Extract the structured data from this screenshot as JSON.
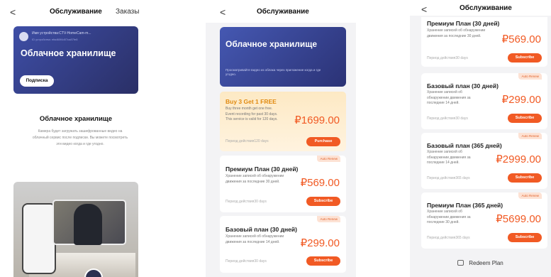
{
  "screen1": {
    "header": {
      "back": "<",
      "title": "Обслуживание",
      "right": "Заказы"
    },
    "banner": {
      "device_name": "Имя устройства:CTV-HomeCam-m...",
      "device_sub": "ID устройства: efad60f4d07ca87fe8",
      "title": "Облачное хранилище",
      "button": "Подписка"
    },
    "section_title": "Облачное хранилище",
    "section_desc": "Камера будет загружать зашифрованные видео на облачный сервис после подписки. Вы можете посмотреть эти видео когда и где угодно."
  },
  "screen2": {
    "header": {
      "back": "<",
      "title": "Обслуживание"
    },
    "banner": {
      "title": "Облачное хранилище",
      "desc": "Просматривайте видео из облака через приложение когда и где угодно."
    },
    "cards": [
      {
        "title": "Buy 3 Get 1 FREE",
        "desc": "Buy three month get one free. Event recording for past 30 days. This service is valid for 120 days.",
        "price": "₽1699.00",
        "period": "Период действия120 days",
        "button": "Purchase",
        "badge": ""
      },
      {
        "title": "Премиум План (30 дней)",
        "desc": "Хранение записей об обнаружении движения за последние 30 дней.",
        "price": "₽569.00",
        "period": "Период действия30 days",
        "button": "Subscribe",
        "badge": "Auto Renew"
      },
      {
        "title": "Базовый план (30 дней)",
        "desc": "Хранение записей об обнаружении движения за последние 14 дней.",
        "price": "₽299.00",
        "period": "Период действия30 days",
        "button": "Subscribe",
        "badge": "Auto Renew"
      }
    ]
  },
  "screen3": {
    "header": {
      "back": "<",
      "title": "Обслуживание"
    },
    "cards": [
      {
        "title": "Премиум План (30 дней)",
        "desc": "Хранение записей об обнаружении движения за последние 30 дней.",
        "price": "₽569.00",
        "period": "Период действия30 days",
        "button": "Subscribe",
        "badge": ""
      },
      {
        "title": "Базовый план (30 дней)",
        "desc": "Хранение записей об обнаружении движения за последние 14 дней.",
        "price": "₽299.00",
        "period": "Период действия30 days",
        "button": "Subscribe",
        "badge": "Auto Renew"
      },
      {
        "title": "Базовый план (365 дней)",
        "desc": "Хранение записей об обнаружении движения за последние 14 дней.",
        "price": "₽2999.00",
        "period": "Период действия365 days",
        "button": "Subscribe",
        "badge": "Auto Renew"
      },
      {
        "title": "Премиум План (365 дней)",
        "desc": "Хранение записей об обнаружении движения за последние 30 дней.",
        "price": "₽5699.00",
        "period": "Период действия365 days",
        "button": "Subscribe",
        "badge": "Auto Renew"
      }
    ],
    "redeem": "Redeem Plan"
  },
  "colors": {
    "accent": "#f15a24",
    "banner": "#2f3a86",
    "promo_title": "#e08a10"
  }
}
